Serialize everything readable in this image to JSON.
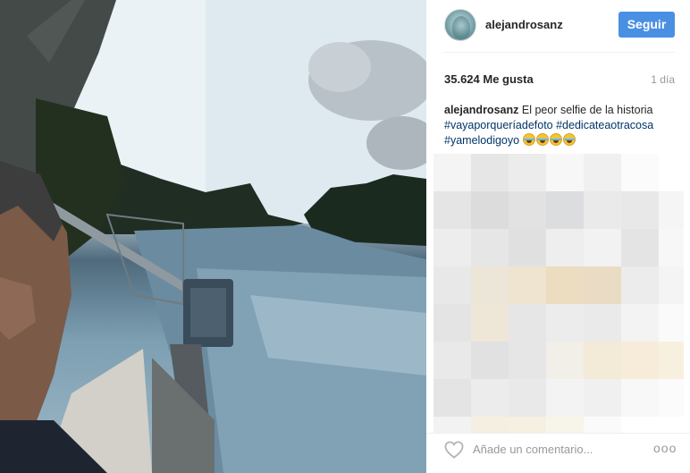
{
  "post": {
    "username": "alejandrosanz",
    "follow_label": "Seguir",
    "likes": "35.624 Me gusta",
    "time": "1 día",
    "caption": {
      "user": "alejandrosanz",
      "text": "El peor selfie de la historia",
      "hashtags": [
        "#vayaporqueríadefoto",
        "#dedicateaotracosa",
        "#yamelodigoyo"
      ],
      "emoji": "face-with-tears-of-joy x4"
    }
  },
  "comment_bar": {
    "placeholder": "Añade un comentario...",
    "like_icon": "heart-outline-icon",
    "more_icon": "ellipsis-icon",
    "more_label": "ooo"
  },
  "colors": {
    "follow_button": "#4a90e2",
    "hashtag": "#003569",
    "secondary_text": "#999999",
    "divider": "#efefef"
  }
}
